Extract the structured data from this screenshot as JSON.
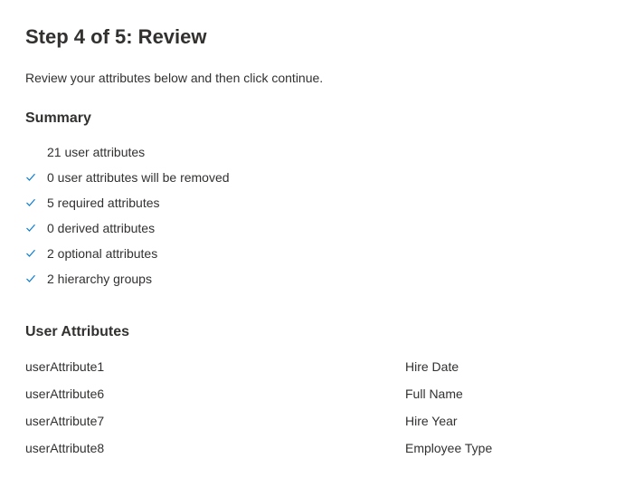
{
  "title": "Step 4 of 5: Review",
  "intro": "Review your attributes below and then click continue.",
  "summary": {
    "heading": "Summary",
    "items": [
      {
        "text": "21 user attributes",
        "check": false
      },
      {
        "text": "0 user attributes will be removed",
        "check": true
      },
      {
        "text": "5 required attributes",
        "check": true
      },
      {
        "text": "0 derived attributes",
        "check": true
      },
      {
        "text": "2 optional attributes",
        "check": true
      },
      {
        "text": "2 hierarchy groups",
        "check": true
      }
    ]
  },
  "userAttributes": {
    "heading": "User Attributes",
    "rows": [
      {
        "left": "userAttribute1",
        "right": "Hire Date"
      },
      {
        "left": "userAttribute6",
        "right": "Full Name"
      },
      {
        "left": "userAttribute7",
        "right": "Hire Year"
      },
      {
        "left": "userAttribute8",
        "right": "Employee Type"
      }
    ]
  }
}
